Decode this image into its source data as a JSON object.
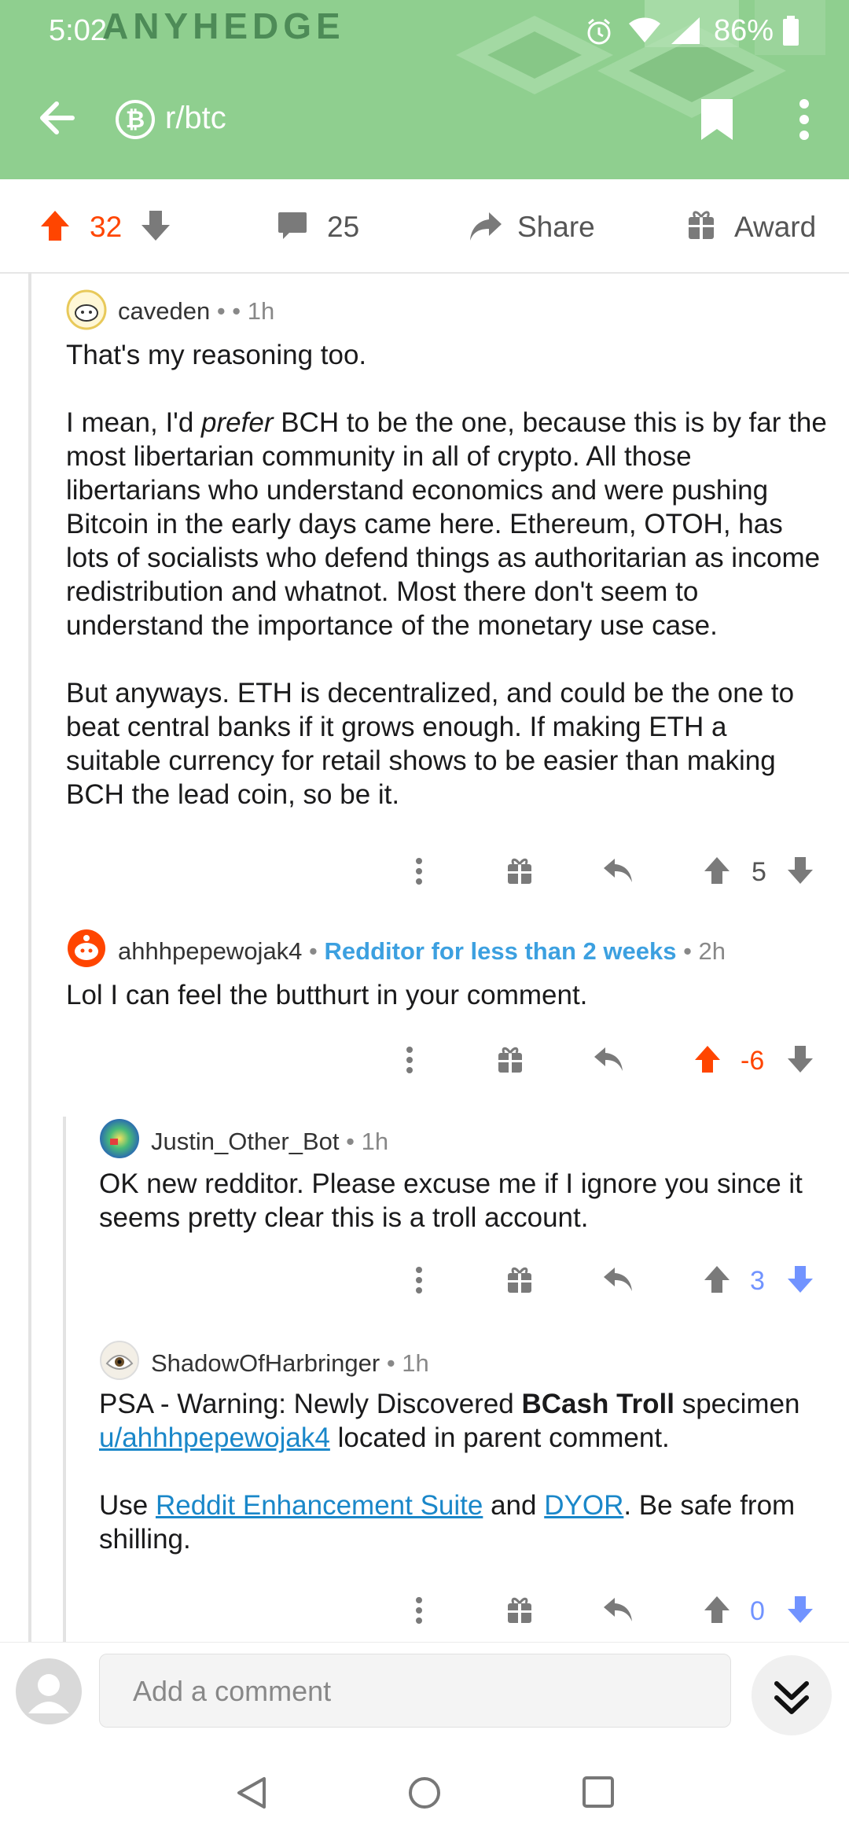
{
  "status_bar": {
    "time": "5:02",
    "brand_banner": "ANYHEDGE",
    "battery_percent": "86%"
  },
  "toolbar": {
    "subreddit": "r/btc"
  },
  "post_actions": {
    "score": "32",
    "comments": "25",
    "share_label": "Share",
    "award_label": "Award"
  },
  "comments": [
    {
      "author": "caveden",
      "meta": " • • 1h",
      "paragraphs": [
        "That's my reasoning too.",
        "the most libertarian community in all of crypto. All those libertarians who understand economics and were pushing Bitcoin in the early days came here. Ethereum, OTOH, has lots of socialists who defend things as authoritarian as income redistribution and whatnot. Most there don't seem to understand the importance of the monetary use case.",
        "But anyways. ETH is decentralized, and could be the one to beat central banks if it grows enough. If making ETH a suitable currency for retail shows to be easier than making BCH the lead coin, so be it."
      ],
      "p2_start": "I mean, I'd ",
      "p2_em": "prefer",
      "p2_after": " BCH to be the one, because this is by far",
      "score": "5"
    },
    {
      "author": "ahhhpepewojak4",
      "flair_sep": " • ",
      "flair": "Redditor for less than 2 weeks",
      "meta": " • 2h",
      "text": "Lol I can feel the butthurt in your comment.",
      "score": "-6"
    },
    {
      "author": "Justin_Other_Bot",
      "meta": " • 1h",
      "text": "OK new redditor. Please excuse me if I ignore you since it seems pretty clear this is a troll account.",
      "score": "3"
    },
    {
      "author": "ShadowOfHarbringer",
      "meta": " • 1h",
      "p1_a": "PSA - Warning: Newly Discovered ",
      "p1_bold": "BCash Troll",
      "p1_b": " specimen ",
      "p1_link": "u/ahhhpepewojak4",
      "p1_c": " located in parent comment.",
      "p2_a": "Use ",
      "p2_link1": "Reddit Enhancement Suite",
      "p2_b": " and ",
      "p2_link2": "DYOR",
      "p2_c": ". Be safe from shilling.",
      "score": "0"
    }
  ],
  "composer": {
    "placeholder": "Add a comment"
  },
  "colors": {
    "header_bg": "#8fcf8f",
    "upvote_active": "#ff4500",
    "downvote_active": "#7193ff",
    "flair": "#3ca0e0",
    "link": "#1a87c9"
  }
}
